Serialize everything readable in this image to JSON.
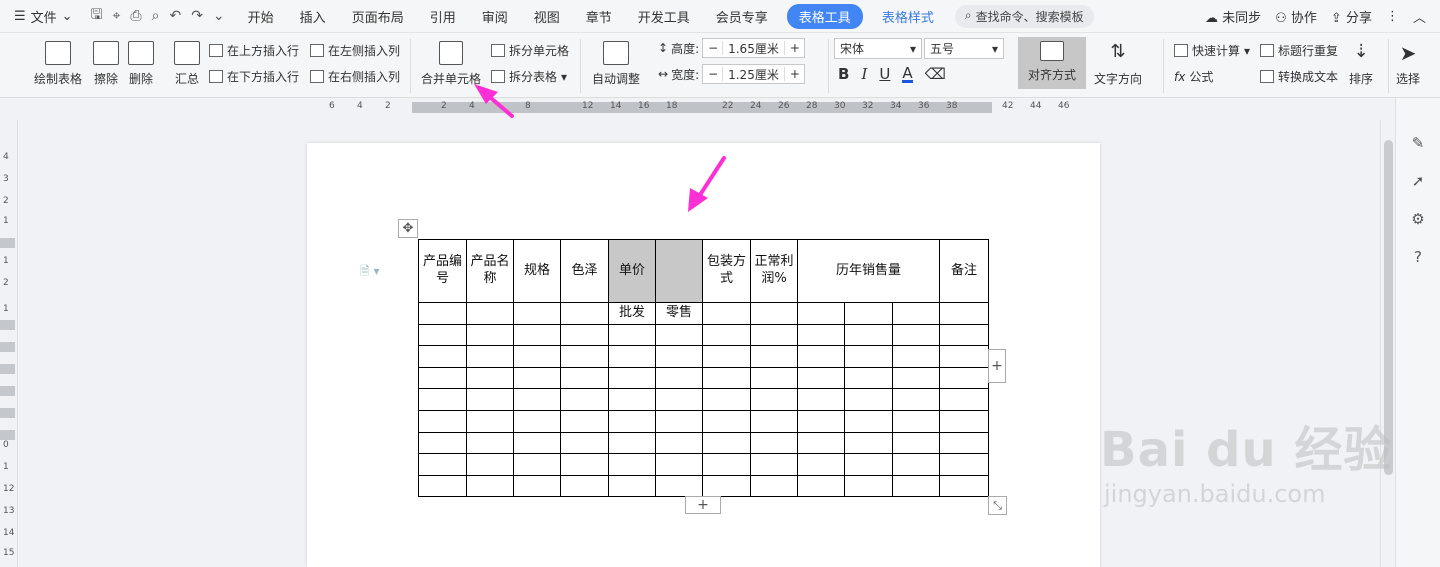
{
  "menubar": {
    "file_label": "文件",
    "tabs": [
      "开始",
      "插入",
      "页面布局",
      "引用",
      "审阅",
      "视图",
      "章节",
      "开发工具",
      "会员专享"
    ],
    "active_tab": "表格工具",
    "extra_tab": "表格样式",
    "search_placeholder": "查找命令、搜索模板",
    "unsync": "未同步",
    "collab": "协作",
    "share": "分享"
  },
  "ribbon": {
    "draw_table": "绘制表格",
    "erase": "擦除",
    "delete": "删除",
    "summary": "汇总",
    "insert_above": "在上方插入行",
    "insert_below": "在下方插入行",
    "insert_left": "在左侧插入列",
    "insert_right": "在右侧插入列",
    "merge_cells": "合并单元格",
    "split_cells": "拆分单元格",
    "split_table": "拆分表格",
    "auto_fit": "自动调整",
    "height_label": "高度:",
    "height_value": "1.65厘米",
    "width_label": "宽度:",
    "width_value": "1.25厘米",
    "font_name": "宋体",
    "font_size": "五号",
    "align": "对齐方式",
    "text_direction": "文字方向",
    "quick_calc": "快速计算",
    "repeat_header": "标题行重复",
    "formula": "公式",
    "to_text": "转换成文本",
    "sort": "排序",
    "select": "选择"
  },
  "ruler": {
    "top_ticks": [
      "6",
      "4",
      "2",
      "2",
      "4",
      "8",
      "12",
      "14",
      "16",
      "18",
      "22",
      "24",
      "26",
      "28",
      "30",
      "32",
      "34",
      "36",
      "38",
      "42",
      "44",
      "46"
    ],
    "left_ticks": [
      "4",
      "3",
      "2",
      "1",
      "1",
      "2",
      "1",
      "0",
      "1",
      "12",
      "13",
      "14",
      "15"
    ]
  },
  "table": {
    "header": [
      "产品编号",
      "产品名称",
      "规格",
      "色泽",
      "单价",
      "",
      "包装方式",
      "正常利润%",
      "历年销售量",
      "备注"
    ],
    "subheader": [
      "批发",
      "零售"
    ],
    "empty_rows": 8
  },
  "watermark": {
    "brand": "Bai du 经验",
    "url": "jingyan.baidu.com"
  },
  "colors": {
    "accent": "#4285f4",
    "arrow": "#ff2fd6",
    "selected_cell": "#c8c8c8"
  }
}
